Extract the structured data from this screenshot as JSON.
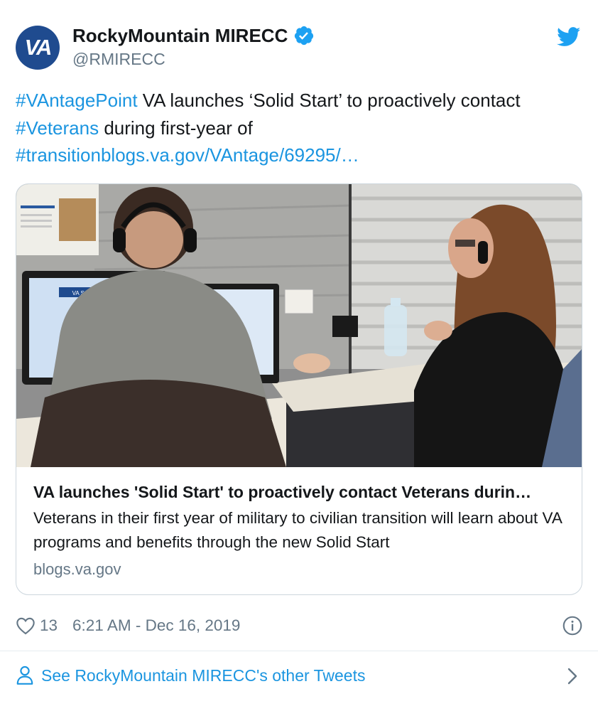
{
  "author": {
    "avatar_text": "VA",
    "display_name": "RockyMountain MIRECC",
    "handle": "@RMIRECC",
    "verified": true,
    "verified_icon": "verified-badge-icon",
    "brand_icon": "twitter-bird-icon"
  },
  "tweet": {
    "segments": [
      {
        "type": "link",
        "text": "#VAntagePoint"
      },
      {
        "type": "text",
        "text": " VA launches ‘Solid Start’ to proactively contact "
      },
      {
        "type": "link",
        "text": "#Veterans"
      },
      {
        "type": "text",
        "text": " during first-year of "
      },
      {
        "type": "link",
        "text": "#transitionblogs.va.gov/VAntage/69295/…"
      }
    ]
  },
  "card": {
    "image_sign_text": "VA Solid Start",
    "title": "VA launches 'Solid Start' to proactively contact Veterans durin…",
    "description": "Veterans in their first year of military to civilian transition will learn about VA programs and benefits through the new Solid Start",
    "domain": "blogs.va.gov"
  },
  "meta": {
    "like_count": "13",
    "timestamp": "6:21 AM - Dec 16, 2019",
    "like_icon": "heart-icon",
    "info_icon": "info-icon"
  },
  "footer": {
    "label": "See RockyMountain MIRECC's other Tweets",
    "icon": "person-icon",
    "chevron": "chevron-right-icon"
  },
  "colors": {
    "link": "#1b95e0",
    "secondary_text": "#657786",
    "primary_text": "#14171a",
    "avatar_bg": "#1f4b8f",
    "border": "#ccd6dd"
  }
}
